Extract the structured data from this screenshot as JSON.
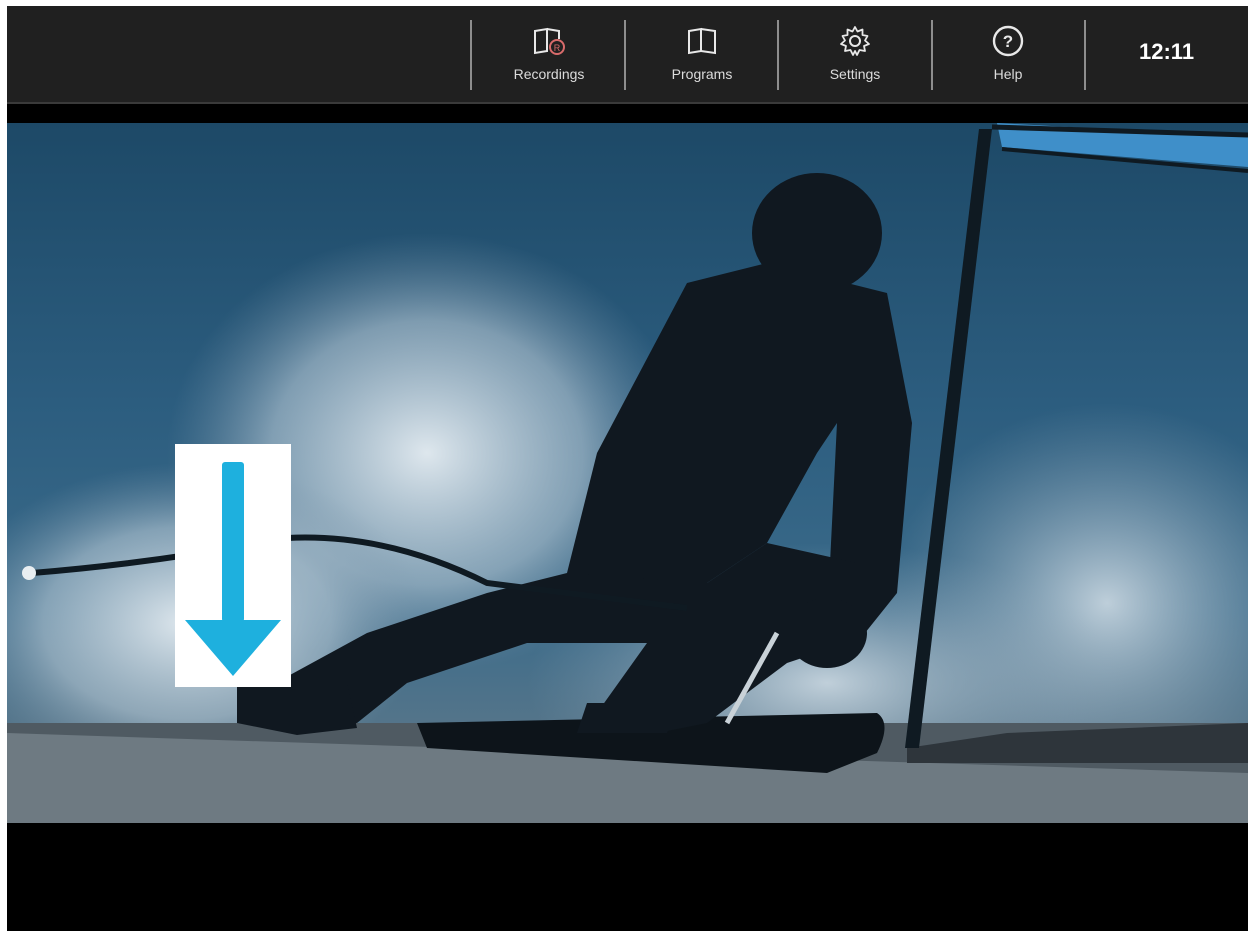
{
  "header": {
    "nav": [
      {
        "label": "Recordings",
        "icon": "recordings-book-icon"
      },
      {
        "label": "Programs",
        "icon": "open-book-icon"
      },
      {
        "label": "Settings",
        "icon": "gear-icon"
      },
      {
        "label": "Help",
        "icon": "question-circle-icon"
      }
    ],
    "clock": "12:11"
  },
  "video": {
    "scene": "alpine-skier-silhouette",
    "hint_icon": "arrow-down-icon"
  },
  "colors": {
    "topbar": "#202020",
    "arrow": "#1eb0de",
    "sky": "#2c5d7f"
  }
}
